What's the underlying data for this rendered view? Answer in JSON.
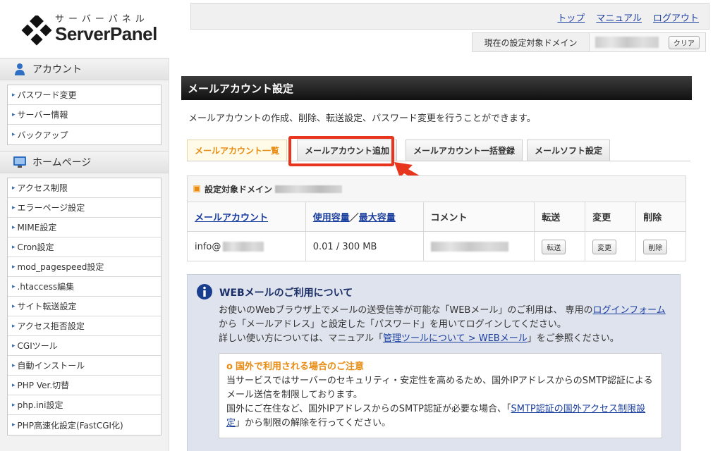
{
  "logo": {
    "sub": "サーバーパネル",
    "main": "ServerPanel"
  },
  "toplinks": [
    "トップ",
    "マニュアル",
    "ログアウト"
  ],
  "domainbar": {
    "label": "現在の設定対象ドメイン",
    "clear": "クリア"
  },
  "sidebar": {
    "account": {
      "title": "アカウント",
      "items": [
        "パスワード変更",
        "サーバー情報",
        "バックアップ"
      ]
    },
    "homepage": {
      "title": "ホームページ",
      "items": [
        "アクセス制限",
        "エラーページ設定",
        "MIME設定",
        "Cron設定",
        "mod_pagespeed設定",
        ".htaccess編集",
        "サイト転送設定",
        "アクセス拒否設定",
        "CGIツール",
        "自動インストール",
        "PHP Ver.切替",
        "php.ini設定",
        "PHP高速化設定(FastCGI化)"
      ]
    }
  },
  "main": {
    "title": "メールアカウント設定",
    "desc": "メールアカウントの作成、削除、転送設定、パスワード変更を行うことができます。",
    "tabs": [
      "メールアカウント一覧",
      "メールアカウント追加",
      "メールアカウント一括登録",
      "メールソフト設定"
    ],
    "caption": "設定対象ドメイン",
    "headers": {
      "account": "メールアカウント",
      "usage": "使用容量",
      "slash": "／",
      "max": "最大容量",
      "comment": "コメント",
      "forward": "転送",
      "change": "変更",
      "delete": "削除"
    },
    "row": {
      "account": "info@",
      "usage": "0.01 / 300 MB",
      "forward": "転送",
      "change": "変更",
      "delete": "削除"
    }
  },
  "info": {
    "title": "WEBメールのご利用について",
    "l1a": "お使いのWebブラウザ上でメールの送受信等が可能な「WEBメール」のご利用は、 専用の",
    "link1a": "ログインフォ",
    "link1b": "ーム",
    "l2": "から「メールアドレス」と設定した「パスワード」を用いてログインしてください。",
    "l3a": "詳しい使い方については、マニュアル「",
    "link2": "管理ツールについて > WEBメール",
    "l3b": "」をご参照ください。",
    "notice": {
      "title": "国外で利用される場合のご注意",
      "p1": "当サービスではサーバーのセキュリティ・安定性を高めるため、国外IPアドレスからのSMTP認証によるメール送信を制限しております。",
      "p2a": "国外にご在住など、国外IPアドレスからのSMTP認証が必要な場合、「",
      "link": "SMTP認証の国外アクセス制限",
      "link2": "設定",
      "p2b": "」から制限の解除を行ってください。"
    }
  },
  "colors": {
    "accent": "#e88b12",
    "highlight": "#e8351e",
    "link": "#1a3e9e"
  }
}
